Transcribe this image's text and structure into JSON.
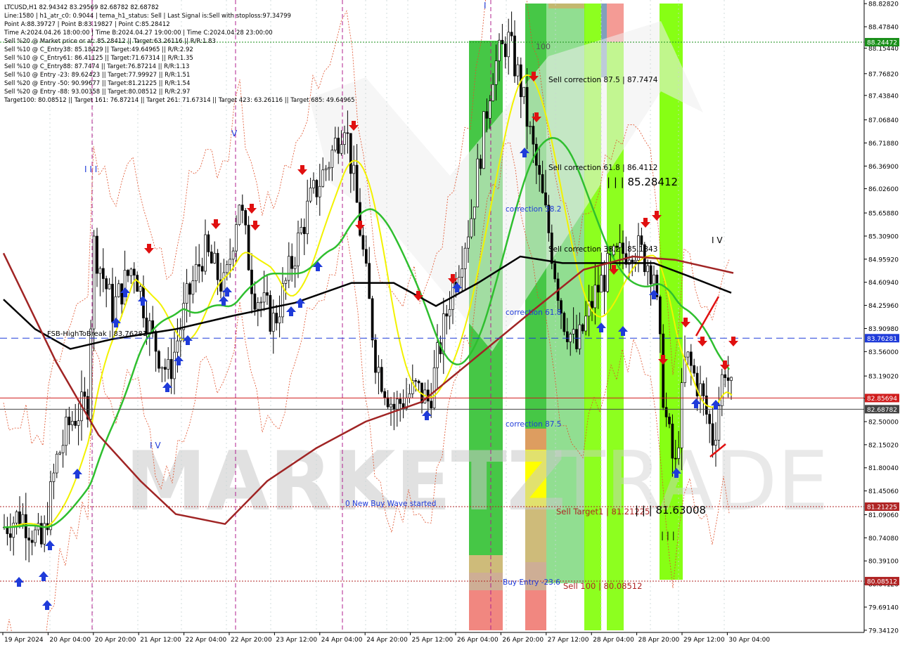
{
  "chart_data": {
    "type": "candlestick",
    "symbol_header": "LTCUSD,H1  82.94342 83.29569 82.68782 82.68782",
    "info_lines": [
      "Line:1580  | h1_atr_c0: 0.9044  | tema_h1_status: Sell  | Last Signal is:Sell with stoploss:97.34799",
      "Point A:88.39727  | Point B:83.19827  | Point C:85.28412",
      "Time A:2024.04.26 18:00:00  | Time B:2024.04.27 19:00:00  | Time C:2024.04.28 23:00:00",
      "Sell %20 @ Market price or at: 85.28412  || Target:63.26116  || R/R:1.83",
      "Sell %10 @ C_Entry38: 85.18429  || Target:49.64965  || R/R:2.92",
      "Sell %10 @ C_Entry61: 86.41125  || Target:71.67314  || R/R:1.35",
      "Sell %10 @ C_Entry88: 87.7474  || Target:76.87214  || R/R:1.13",
      "Sell %10 @ Entry -23: 89.62423  || Target:77.99927  || R/R:1.51",
      "Sell %20 @ Entry -50: 90.99677  || Target:81.21225  || R/R:1.54",
      "Sell %20 @ Entry -88: 93.00358  || Target:80.08512  || R/R:2.97",
      "Target100: 80.08512  || Target 161: 76.87214  || Target 261: 71.67314  || Target 423: 63.26116  || Target 685: 49.64965"
    ],
    "y_ticks": [
      "88.82820",
      "88.47840",
      "88.15440",
      "87.76820",
      "87.43840",
      "87.06840",
      "86.71880",
      "86.36900",
      "86.02600",
      "85.65880",
      "85.30900",
      "84.95920",
      "84.60940",
      "84.25960",
      "83.90980",
      "83.56000",
      "83.19020",
      "82.85040",
      "82.50000",
      "82.15020",
      "81.80040",
      "81.45060",
      "81.09060",
      "80.74080",
      "80.39100",
      "80.04120",
      "79.69140",
      "79.34120"
    ],
    "y_tick_values": [
      88.8282,
      88.4784,
      88.1544,
      87.7682,
      87.4384,
      87.0684,
      86.7188,
      86.369,
      86.026,
      85.6588,
      85.309,
      84.9592,
      84.6094,
      84.2596,
      83.9098,
      83.56,
      83.1902,
      82.8504,
      82.5,
      82.1502,
      81.8004,
      81.4506,
      81.0906,
      80.7408,
      80.391,
      80.0412,
      79.6914,
      79.3412
    ],
    "x_ticks": [
      "19 Apr 2024",
      "20 Apr 04:00",
      "20 Apr 20:00",
      "21 Apr 12:00",
      "22 Apr 04:00",
      "22 Apr 20:00",
      "23 Apr 12:00",
      "24 Apr 04:00",
      "24 Apr 20:00",
      "25 Apr 12:00",
      "26 Apr 04:00",
      "26 Apr 20:00",
      "27 Apr 12:00",
      "28 Apr 04:00",
      "28 Apr 20:00",
      "29 Apr 12:00",
      "30 Apr 04:00"
    ],
    "y_range": [
      79.34,
      88.83
    ],
    "horizontal_levels": [
      {
        "value": 88.24472,
        "label": "88.24472",
        "color": "#1a8f1a",
        "style": "dotted"
      },
      {
        "value": 83.76281,
        "label": "83.76281",
        "color": "#1f3bd9",
        "style": "dashed"
      },
      {
        "value": 82.85694,
        "label": "82.85694",
        "color": "#d01c1c",
        "style": "solid"
      },
      {
        "value": 82.68782,
        "label": "82.68782",
        "color": "#444444",
        "style": "solid"
      },
      {
        "value": 81.21225,
        "label": "81.21225",
        "color": "#b02424",
        "style": "dotted"
      },
      {
        "value": 80.08512,
        "label": "80.08512",
        "color": "#b02424",
        "style": "dotted"
      }
    ],
    "annotations": {
      "fsb": "FSB-HighToBreak  | 83.76281",
      "sell_correction_875": "Sell correction 87.5 | 87.7474",
      "sell_correction_618": "Sell correction 61.8 | 86.4112",
      "sell_correction_382": "Sell correction 38.2 | 85.1843",
      "point_c": "| | | 85.28412",
      "correction_382": "correction 38.2",
      "correction_618": "correction 61.8",
      "correction_875": "correction 87.5",
      "new_buy_wave": "0 New Buy Wave started",
      "sell_target1": "Sell Target1 | 81.21225",
      "point_b_low": "| | | 81.63008",
      "buy_entry": "Buy Entry -23.6",
      "sell_100": "Sell 100 | 80.08512",
      "label_100": "100",
      "wave_a": "| | |",
      "wave_iv": "I V",
      "wave_v": "V",
      "wave_iv2": "I V",
      "wave_iii": "I I I",
      "wave_top": "I"
    },
    "watermark": "MARKETZ TRADE",
    "colors": {
      "bull": "#ffffff",
      "bear": "#000000",
      "ma_fast": "#f2f200",
      "ma_mid": "#2fbf2f",
      "ma_slow": "#000000",
      "ma_long": "#a02424",
      "env": "#e0502a",
      "zone_green": "#36c236",
      "zone_lime": "#7dff00"
    }
  }
}
